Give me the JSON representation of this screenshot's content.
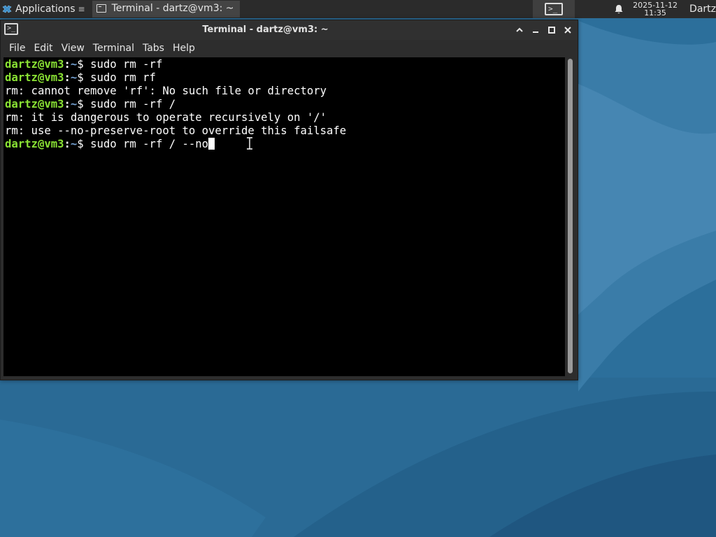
{
  "panel": {
    "applications_label": "Applications",
    "task_title": "Terminal - dartz@vm3: ~",
    "clock_date": "2025-11-12",
    "clock_time": "11:35",
    "user": "Dartz"
  },
  "window": {
    "title": "Terminal - dartz@vm3: ~"
  },
  "menu": {
    "items": [
      "File",
      "Edit",
      "View",
      "Terminal",
      "Tabs",
      "Help"
    ]
  },
  "terminal": {
    "prompt_user": "dartz@vm3",
    "prompt_sep": ":",
    "prompt_path": "~",
    "prompt_symbol": "$ ",
    "lines": [
      {
        "type": "prompt",
        "command": "sudo rm -rf"
      },
      {
        "type": "prompt",
        "command": "sudo rm rf"
      },
      {
        "type": "output",
        "text": "rm: cannot remove 'rf': No such file or directory"
      },
      {
        "type": "prompt",
        "command": "sudo rm -rf /"
      },
      {
        "type": "output",
        "text": "rm: it is dangerous to operate recursively on '/'"
      },
      {
        "type": "output",
        "text": "rm: use --no-preserve-root to override this failsafe"
      },
      {
        "type": "prompt",
        "command": "sudo rm -rf / --no",
        "cursor": true
      }
    ]
  },
  "colors": {
    "prompt_user": "#8ae234",
    "prompt_path": "#729fcf",
    "terminal_bg": "#000000",
    "panel_bg": "#2b2b2b",
    "desktop_bg": "#2b6d98"
  }
}
